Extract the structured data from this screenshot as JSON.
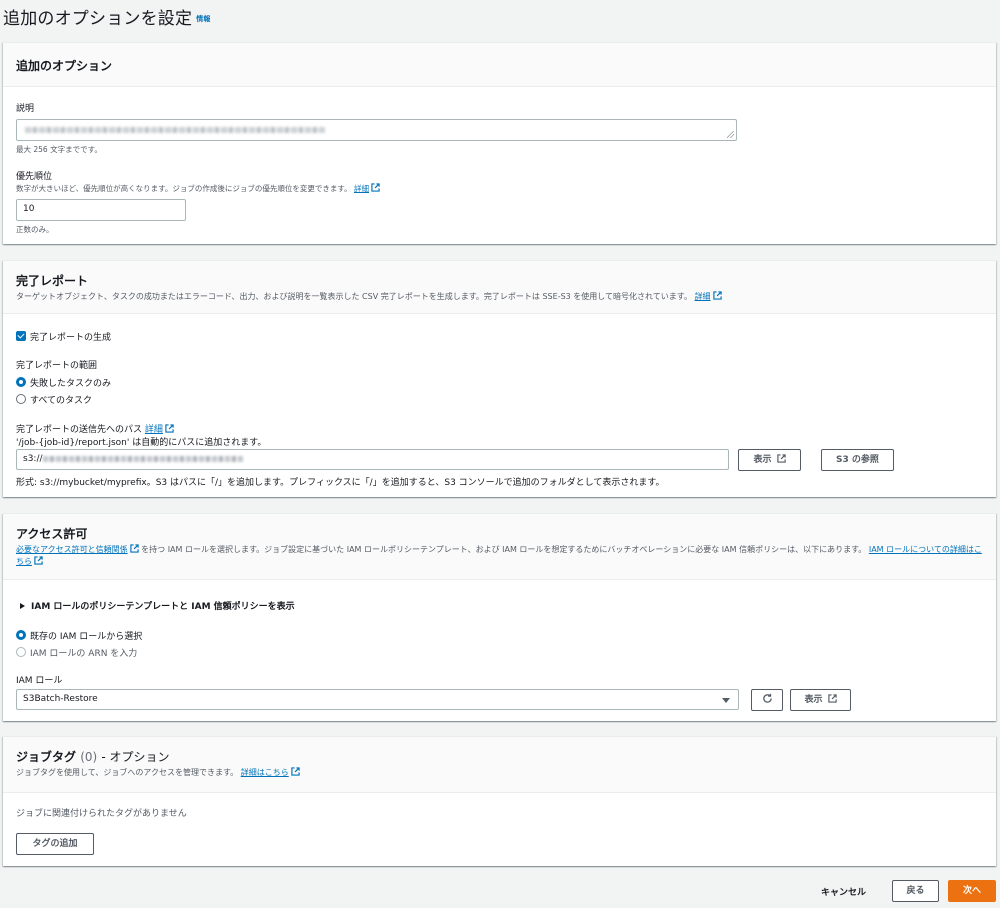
{
  "page": {
    "title": "追加のオプションを設定",
    "info_label": "情報"
  },
  "options": {
    "title": "追加のオプション",
    "description_label": "説明",
    "description_constraint": "最大 256 文字までです。",
    "priority_label": "優先順位",
    "priority_hint": "数字が大きいほど、優先順位が高くなります。ジョブの作成後にジョブの優先順位を変更できます。",
    "priority_link": "詳細",
    "priority_value": "10",
    "priority_constraint": "正数のみ。"
  },
  "report": {
    "title": "完了レポート",
    "description": "ターゲットオブジェクト、タスクの成功またはエラーコード、出力、および説明を一覧表示した CSV 完了レポートを生成します。完了レポートは SSE-S3 を使用して暗号化されています。",
    "description_link": "詳細",
    "generate_label": "完了レポートの生成",
    "scope_label": "完了レポートの範囲",
    "scope_failed": "失敗したタスクのみ",
    "scope_all": "すべてのタスク",
    "path_label": "完了レポートの送信先へのパス",
    "path_link": "詳細",
    "path_hint": "'/job-{job-id}/report.json' は自動的にパスに追加されます。",
    "path_prefix": "s3://",
    "view_button": "表示",
    "browse_button": "S3 の参照",
    "format_hint": "形式: s3://mybucket/myprefix。S3 はパスに「/」を追加します。プレフィックスに「/」を追加すると、S3 コンソールで追加のフォルダとして表示されます。"
  },
  "permissions": {
    "title": "アクセス許可",
    "desc_link1": "必要なアクセス許可と信頼関係",
    "desc_text": "を持つ IAM ロールを選択します。ジョブ設定に基づいた IAM ロールポリシーテンプレート、および IAM ロールを想定するためにバッチオペレーションに必要な IAM 信頼ポリシーは、以下にあります。",
    "desc_link2": "IAM ロールについての詳細はこちら",
    "expand_label": "IAM ロールのポリシーテンプレートと IAM 信頼ポリシーを表示",
    "radio_existing": "既存の IAM ロールから選択",
    "radio_arn": "IAM ロールの ARN を入力",
    "role_label": "IAM ロール",
    "role_value": "S3Batch-Restore",
    "view_button": "表示"
  },
  "tags": {
    "title": "ジョブタグ",
    "count": "(0)",
    "optional": "- オプション",
    "description": "ジョブタグを使用して、ジョブへのアクセスを管理できます。",
    "description_link": "詳細はこちら",
    "empty": "ジョブに関連付けられたタグがありません",
    "add_button": "タグの追加"
  },
  "footer": {
    "cancel": "キャンセル",
    "back": "戻る",
    "next": "次へ"
  },
  "colors": {
    "link": "#0073bb",
    "primary": "#ec7211",
    "background": "#f2f3f3"
  }
}
